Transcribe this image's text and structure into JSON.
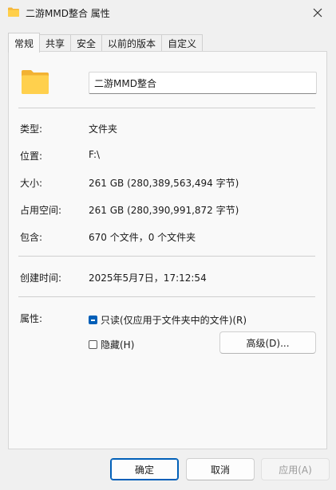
{
  "window": {
    "title": "二游MMD整合 属性",
    "close_icon": "close-icon",
    "folder_icon": "folder-icon"
  },
  "tabs": [
    {
      "label": "常规",
      "active": true
    },
    {
      "label": "共享",
      "active": false
    },
    {
      "label": "安全",
      "active": false
    },
    {
      "label": "以前的版本",
      "active": false
    },
    {
      "label": "自定义",
      "active": false
    }
  ],
  "general": {
    "name_value": "二游MMD整合",
    "type_label": "类型:",
    "type_value": "文件夹",
    "location_label": "位置:",
    "location_value": "F:\\",
    "size_label": "大小:",
    "size_value": "261 GB (280,389,563,494 字节)",
    "disk_size_label": "占用空间:",
    "disk_size_value": "261 GB (280,390,991,872 字节)",
    "contains_label": "包含:",
    "contains_value": "670 个文件，0 个文件夹",
    "created_label": "创建时间:",
    "created_value": "2025年5月7日，17:12:54",
    "attributes_label": "属性:",
    "readonly_label": "只读(仅应用于文件夹中的文件)(R)",
    "readonly_state": "indeterminate",
    "hidden_label": "隐藏(H)",
    "hidden_state": "unchecked",
    "advanced_button": "高级(D)..."
  },
  "footer": {
    "ok_label": "确定",
    "cancel_label": "取消",
    "apply_label": "应用(A)"
  },
  "colors": {
    "folder_yellow": "#ffc83d",
    "accent_blue": "#005fb8"
  }
}
